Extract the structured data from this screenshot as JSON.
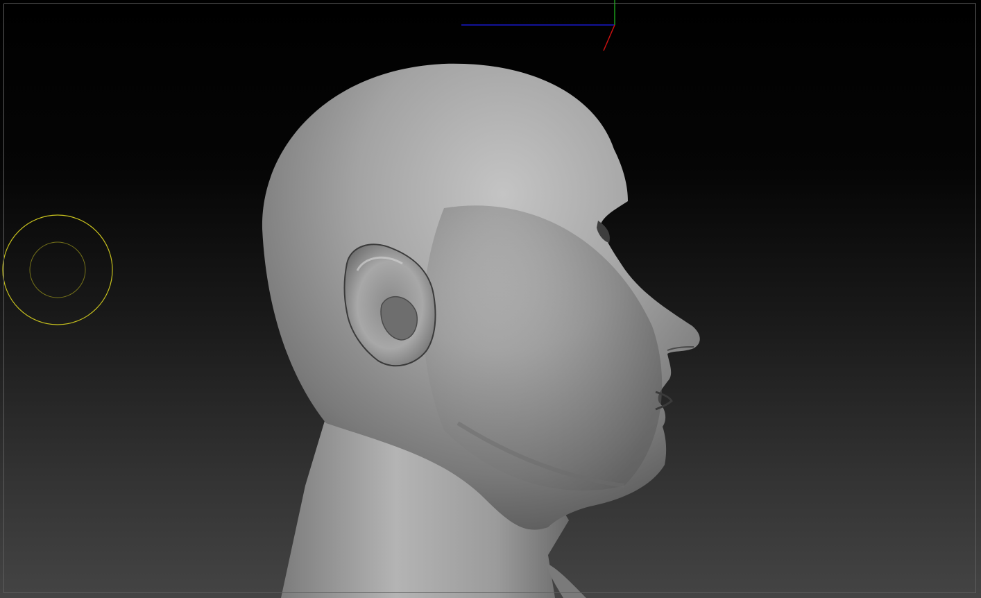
{
  "app": {
    "view": "document-viewport"
  },
  "canvas": {
    "background_top": "#000000",
    "background_bottom": "#444444",
    "frame_color": "#5e5e5e"
  },
  "gizmo": {
    "icon": "axis-gizmo-icon",
    "x_axis_color": "#cc1111",
    "y_axis_color": "#1a9a1a",
    "z_axis_color": "#1818cc"
  },
  "brush_cursor": {
    "icon": "brush-cursor-icon",
    "color": "#c8c21e"
  },
  "model": {
    "icon": "sculpted-head-model",
    "color": "#9a9a9a"
  }
}
